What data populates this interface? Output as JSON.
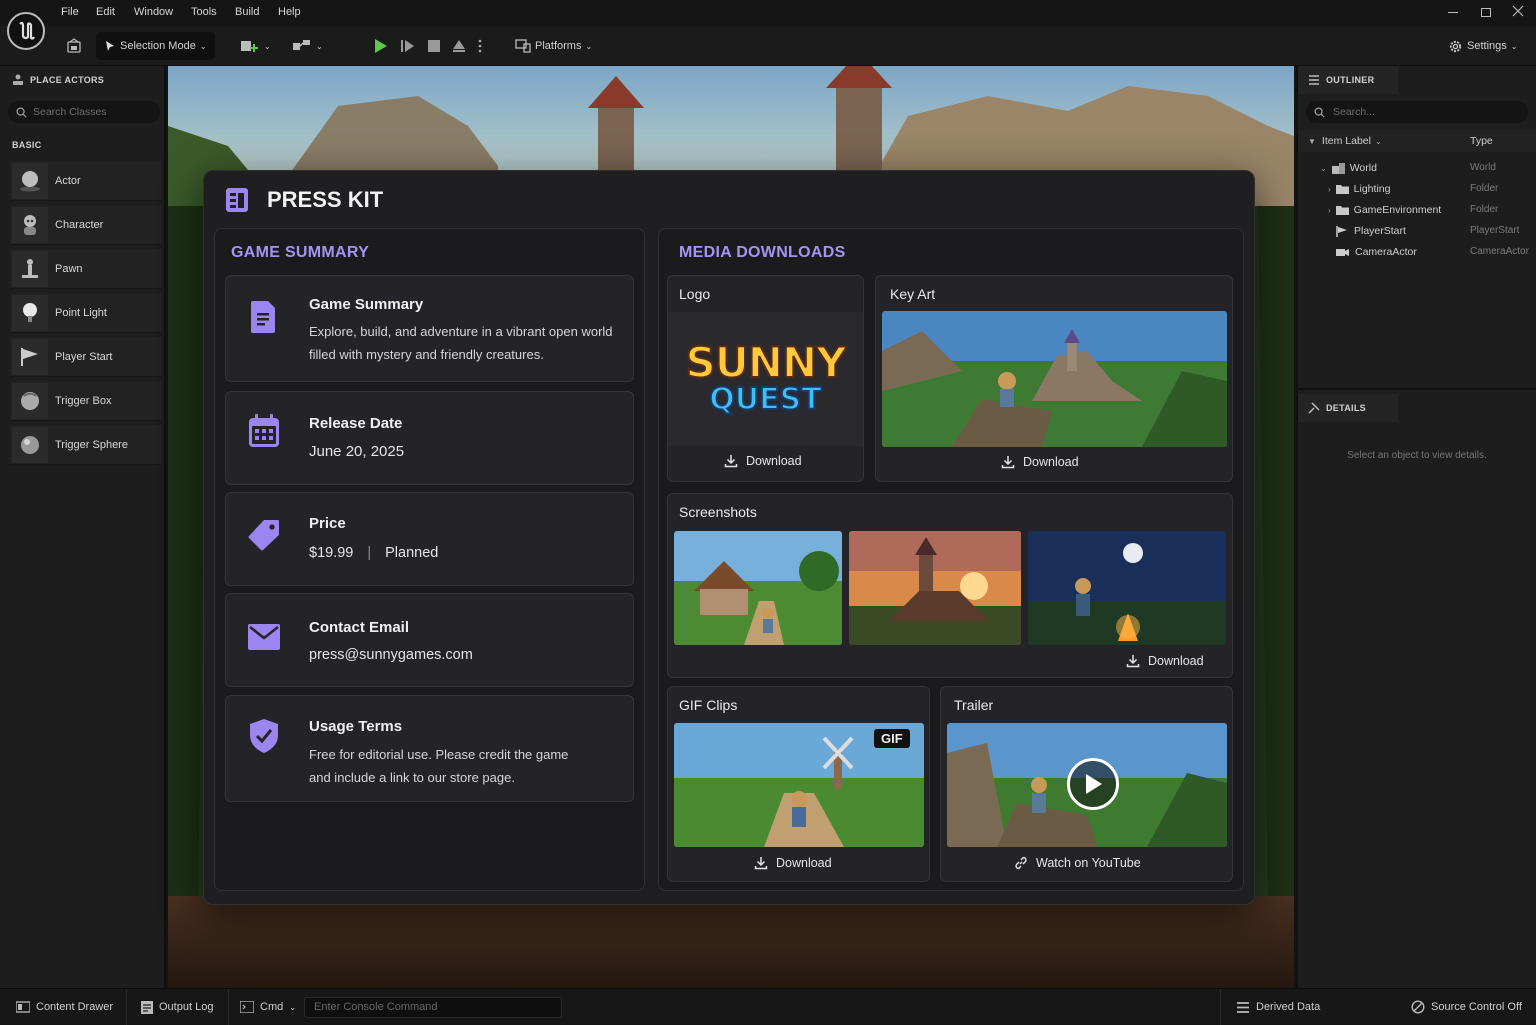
{
  "menu": {
    "items": [
      "File",
      "Edit",
      "Window",
      "Tools",
      "Build",
      "Help"
    ]
  },
  "toolbar": {
    "selection_mode": "Selection Mode",
    "platforms": "Platforms",
    "settings": "Settings"
  },
  "place_actors": {
    "title": "PLACE ACTORS",
    "search_placeholder": "Search Classes",
    "category": "BASIC",
    "items": [
      {
        "label": "Actor",
        "icon": "actor-sphere-icon"
      },
      {
        "label": "Character",
        "icon": "character-icon"
      },
      {
        "label": "Pawn",
        "icon": "pawn-icon"
      },
      {
        "label": "Point Light",
        "icon": "point-light-icon"
      },
      {
        "label": "Player Start",
        "icon": "player-start-flag-icon"
      },
      {
        "label": "Trigger Box",
        "icon": "trigger-box-icon"
      },
      {
        "label": "Trigger Sphere",
        "icon": "trigger-sphere-icon"
      }
    ]
  },
  "outliner": {
    "title": "OUTLINER",
    "search_placeholder": "Search...",
    "col_label": "Item Label",
    "col_type": "Type",
    "rows": [
      {
        "label": "World",
        "type": "World"
      },
      {
        "label": "Lighting",
        "type": "Folder"
      },
      {
        "label": "GameEnvironment",
        "type": "Folder"
      },
      {
        "label": "PlayerStart",
        "type": "PlayerStart"
      },
      {
        "label": "CameraActor",
        "type": "CameraActor"
      }
    ]
  },
  "details": {
    "title": "DETAILS",
    "empty": "Select an object to view details."
  },
  "presskit": {
    "title": "PRESS KIT",
    "summary": {
      "heading": "GAME SUMMARY",
      "game_summary": {
        "title": "Game Summary",
        "line1": "Explore, build, and adventure in a vibrant open world",
        "line2": "filled with mystery and friendly creatures."
      },
      "release": {
        "title": "Release Date",
        "value": "June 20, 2025"
      },
      "price": {
        "title": "Price",
        "value": "$19.99",
        "sep": "|",
        "status": "Planned"
      },
      "contact": {
        "title": "Contact Email",
        "value": "press@sunnygames.com"
      },
      "usage": {
        "title": "Usage Terms",
        "line1": "Free for editorial use. Please credit the game",
        "line2": "and include a link to our store page."
      }
    },
    "media": {
      "heading": "MEDIA DOWNLOADS",
      "logo": {
        "label": "Logo",
        "logo_line1": "SUNNY",
        "logo_line2": "QUEST",
        "action": "Download"
      },
      "key_art": {
        "label": "Key Art",
        "action": "Download"
      },
      "screenshots": {
        "label": "Screenshots",
        "action": "Download"
      },
      "gif": {
        "label": "GIF Clips",
        "badge": "GIF",
        "action": "Download"
      },
      "trailer": {
        "label": "Trailer",
        "action": "Watch on YouTube"
      }
    }
  },
  "bottombar": {
    "content_drawer": "Content Drawer",
    "output_log": "Output Log",
    "cmd": "Cmd",
    "console_placeholder": "Enter Console Command",
    "derived_data": "Derived Data",
    "source_control": "Source Control Off"
  },
  "colors": {
    "accent": "#a494f2",
    "icon_purple": "#9a86ee",
    "play_green": "#5fc84a",
    "bg_panel": "#1f1f22"
  }
}
